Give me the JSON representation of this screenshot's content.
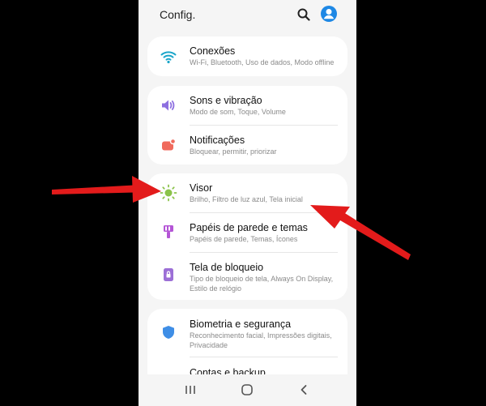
{
  "header": {
    "title": "Config."
  },
  "groups": [
    {
      "items": [
        {
          "title": "Conexões",
          "subtitle": "Wi-Fi, Bluetooth, Uso de dados, Modo offline",
          "icon": "wifi-icon"
        }
      ]
    },
    {
      "items": [
        {
          "title": "Sons e vibração",
          "subtitle": "Modo de som, Toque, Volume",
          "icon": "volume-icon"
        },
        {
          "title": "Notificações",
          "subtitle": "Bloquear, permitir, priorizar",
          "icon": "notification-icon"
        }
      ]
    },
    {
      "items": [
        {
          "title": "Visor",
          "subtitle": "Brilho, Filtro de luz azul, Tela inicial",
          "icon": "brightness-icon"
        },
        {
          "title": "Papéis de parede e temas",
          "subtitle": "Papéis de parede, Temas, Ícones",
          "icon": "paintbrush-icon"
        },
        {
          "title": "Tela de bloqueio",
          "subtitle": "Tipo de bloqueio de tela, Always On Display, Estilo de relógio",
          "icon": "lock-icon"
        }
      ]
    },
    {
      "items": [
        {
          "title": "Biometria e segurança",
          "subtitle": "Reconhecimento facial, Impressões digitais, Privacidade",
          "icon": "shield-icon"
        },
        {
          "title": "Contas e backup",
          "subtitle": "",
          "icon": "key-icon"
        }
      ]
    }
  ],
  "colors": {
    "wifi": "#1aa5c9",
    "volume": "#8d6fe0",
    "notification": "#f06a5c",
    "brightness": "#8bc34a",
    "paintbrush": "#b455d6",
    "lock": "#9c6fd6",
    "shield": "#3f8ee6",
    "key": "#f2b600",
    "arrow": "#e31b1b"
  }
}
